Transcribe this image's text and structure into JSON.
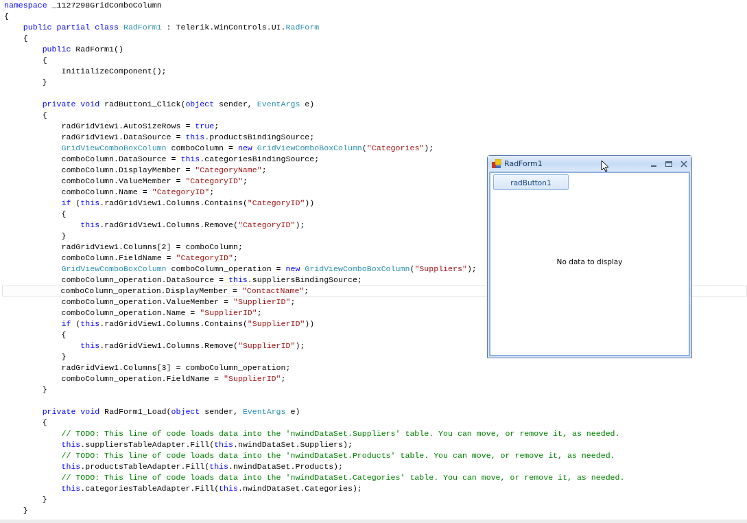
{
  "editor": {
    "lines": [
      {
        "current": false,
        "tokens": [
          {
            "kind": "kw",
            "text": "namespace"
          },
          {
            "kind": "plain",
            "text": " _1127298GridComboColumn"
          }
        ]
      },
      {
        "current": false,
        "tokens": [
          {
            "kind": "plain",
            "text": "{"
          }
        ]
      },
      {
        "current": false,
        "tokens": [
          {
            "kind": "kw",
            "text": "    public partial class "
          },
          {
            "kind": "type",
            "text": "RadForm1"
          },
          {
            "kind": "plain",
            "text": " : Telerik.WinControls.UI."
          },
          {
            "kind": "type",
            "text": "RadForm"
          }
        ]
      },
      {
        "current": false,
        "tokens": [
          {
            "kind": "plain",
            "text": "    {"
          }
        ]
      },
      {
        "current": false,
        "tokens": [
          {
            "kind": "kw",
            "text": "        public"
          },
          {
            "kind": "plain",
            "text": " RadForm1()"
          }
        ]
      },
      {
        "current": false,
        "tokens": [
          {
            "kind": "plain",
            "text": "        {"
          }
        ]
      },
      {
        "current": false,
        "tokens": [
          {
            "kind": "plain",
            "text": "            InitializeComponent();"
          }
        ]
      },
      {
        "current": false,
        "tokens": [
          {
            "kind": "plain",
            "text": "        }"
          }
        ]
      },
      {
        "current": false
      },
      {
        "current": false,
        "tokens": [
          {
            "kind": "kw",
            "text": "        private void"
          },
          {
            "kind": "plain",
            "text": " radButton1_Click("
          },
          {
            "kind": "kw",
            "text": "object"
          },
          {
            "kind": "plain",
            "text": " sender, "
          },
          {
            "kind": "type",
            "text": "EventArgs"
          },
          {
            "kind": "plain",
            "text": " e)"
          }
        ]
      },
      {
        "current": false,
        "tokens": [
          {
            "kind": "plain",
            "text": "        {"
          }
        ]
      },
      {
        "current": false,
        "tokens": [
          {
            "kind": "plain",
            "text": "            radGridView1.AutoSizeRows = "
          },
          {
            "kind": "kw",
            "text": "true"
          },
          {
            "kind": "plain",
            "text": ";"
          }
        ]
      },
      {
        "current": false,
        "tokens": [
          {
            "kind": "plain",
            "text": "            radGridView1.DataSource = "
          },
          {
            "kind": "kw",
            "text": "this"
          },
          {
            "kind": "plain",
            "text": ".productsBindingSource;"
          }
        ]
      },
      {
        "current": false,
        "tokens": [
          {
            "kind": "type",
            "text": "            GridViewComboBoxColumn"
          },
          {
            "kind": "plain",
            "text": " comboColumn = "
          },
          {
            "kind": "kw",
            "text": "new"
          },
          {
            "kind": "type",
            "text": " GridViewComboBoxColumn"
          },
          {
            "kind": "plain",
            "text": "("
          },
          {
            "kind": "str",
            "text": "\"Categories\""
          },
          {
            "kind": "plain",
            "text": ");"
          }
        ]
      },
      {
        "current": false,
        "tokens": [
          {
            "kind": "plain",
            "text": "            comboColumn.DataSource = "
          },
          {
            "kind": "kw",
            "text": "this"
          },
          {
            "kind": "plain",
            "text": ".categoriesBindingSource;"
          }
        ]
      },
      {
        "current": false,
        "tokens": [
          {
            "kind": "plain",
            "text": "            comboColumn.DisplayMember = "
          },
          {
            "kind": "str",
            "text": "\"CategoryName\""
          },
          {
            "kind": "plain",
            "text": ";"
          }
        ]
      },
      {
        "current": false,
        "tokens": [
          {
            "kind": "plain",
            "text": "            comboColumn.ValueMember = "
          },
          {
            "kind": "str",
            "text": "\"CategoryID\""
          },
          {
            "kind": "plain",
            "text": ";"
          }
        ]
      },
      {
        "current": false,
        "tokens": [
          {
            "kind": "plain",
            "text": "            comboColumn.Name = "
          },
          {
            "kind": "str",
            "text": "\"CategoryID\""
          },
          {
            "kind": "plain",
            "text": ";"
          }
        ]
      },
      {
        "current": false,
        "tokens": [
          {
            "kind": "kw",
            "text": "            if"
          },
          {
            "kind": "plain",
            "text": " ("
          },
          {
            "kind": "kw",
            "text": "this"
          },
          {
            "kind": "plain",
            "text": ".radGridView1.Columns.Contains("
          },
          {
            "kind": "str",
            "text": "\"CategoryID\""
          },
          {
            "kind": "plain",
            "text": "))"
          }
        ]
      },
      {
        "current": false,
        "tokens": [
          {
            "kind": "plain",
            "text": "            {"
          }
        ]
      },
      {
        "current": false,
        "tokens": [
          {
            "kind": "kw",
            "text": "                this"
          },
          {
            "kind": "plain",
            "text": ".radGridView1.Columns.Remove("
          },
          {
            "kind": "str",
            "text": "\"CategoryID\""
          },
          {
            "kind": "plain",
            "text": ");"
          }
        ]
      },
      {
        "current": false,
        "tokens": [
          {
            "kind": "plain",
            "text": "            }"
          }
        ]
      },
      {
        "current": false,
        "tokens": [
          {
            "kind": "plain",
            "text": "            radGridView1.Columns[2] = comboColumn;"
          }
        ]
      },
      {
        "current": false,
        "tokens": [
          {
            "kind": "plain",
            "text": "            comboColumn.FieldName = "
          },
          {
            "kind": "str",
            "text": "\"CategoryID\""
          },
          {
            "kind": "plain",
            "text": ";"
          }
        ]
      },
      {
        "current": false,
        "tokens": [
          {
            "kind": "type",
            "text": "            GridViewComboBoxColumn"
          },
          {
            "kind": "plain",
            "text": " comboColumn_operation = "
          },
          {
            "kind": "kw",
            "text": "new"
          },
          {
            "kind": "type",
            "text": " GridViewComboBoxColumn"
          },
          {
            "kind": "plain",
            "text": "("
          },
          {
            "kind": "str",
            "text": "\"Suppliers\""
          },
          {
            "kind": "plain",
            "text": ");"
          }
        ]
      },
      {
        "current": false,
        "tokens": [
          {
            "kind": "plain",
            "text": "            comboColumn_operation.DataSource = "
          },
          {
            "kind": "kw",
            "text": "this"
          },
          {
            "kind": "plain",
            "text": ".suppliersBindingSource;"
          }
        ]
      },
      {
        "current": true,
        "tokens": [
          {
            "kind": "plain",
            "text": "            comboColumn_operation.DisplayMember = "
          },
          {
            "kind": "str",
            "text": "\"ContactName\""
          },
          {
            "kind": "plain",
            "text": ";"
          }
        ]
      },
      {
        "current": false,
        "tokens": [
          {
            "kind": "plain",
            "text": "            comboColumn_operation.ValueMember = "
          },
          {
            "kind": "str",
            "text": "\"SupplierID\""
          },
          {
            "kind": "plain",
            "text": ";"
          }
        ]
      },
      {
        "current": false,
        "tokens": [
          {
            "kind": "plain",
            "text": "            comboColumn_operation.Name = "
          },
          {
            "kind": "str",
            "text": "\"SupplierID\""
          },
          {
            "kind": "plain",
            "text": ";"
          }
        ]
      },
      {
        "current": false,
        "tokens": [
          {
            "kind": "kw",
            "text": "            if"
          },
          {
            "kind": "plain",
            "text": " ("
          },
          {
            "kind": "kw",
            "text": "this"
          },
          {
            "kind": "plain",
            "text": ".radGridView1.Columns.Contains("
          },
          {
            "kind": "str",
            "text": "\"SupplierID\""
          },
          {
            "kind": "plain",
            "text": "))"
          }
        ]
      },
      {
        "current": false,
        "tokens": [
          {
            "kind": "plain",
            "text": "            {"
          }
        ]
      },
      {
        "current": false,
        "tokens": [
          {
            "kind": "kw",
            "text": "                this"
          },
          {
            "kind": "plain",
            "text": ".radGridView1.Columns.Remove("
          },
          {
            "kind": "str",
            "text": "\"SupplierID\""
          },
          {
            "kind": "plain",
            "text": ");"
          }
        ]
      },
      {
        "current": false,
        "tokens": [
          {
            "kind": "plain",
            "text": "            }"
          }
        ]
      },
      {
        "current": false,
        "tokens": [
          {
            "kind": "plain",
            "text": "            radGridView1.Columns[3] = comboColumn_operation;"
          }
        ]
      },
      {
        "current": false,
        "tokens": [
          {
            "kind": "plain",
            "text": "            comboColumn_operation.FieldName = "
          },
          {
            "kind": "str",
            "text": "\"SupplierID\""
          },
          {
            "kind": "plain",
            "text": ";"
          }
        ]
      },
      {
        "current": false,
        "tokens": [
          {
            "kind": "plain",
            "text": "        }"
          }
        ]
      },
      {
        "current": false
      },
      {
        "current": false,
        "tokens": [
          {
            "kind": "kw",
            "text": "        private void"
          },
          {
            "kind": "plain",
            "text": " RadForm1_Load("
          },
          {
            "kind": "kw",
            "text": "object"
          },
          {
            "kind": "plain",
            "text": " sender, "
          },
          {
            "kind": "type",
            "text": "EventArgs"
          },
          {
            "kind": "plain",
            "text": " e)"
          }
        ]
      },
      {
        "current": false,
        "tokens": [
          {
            "kind": "plain",
            "text": "        {"
          }
        ]
      },
      {
        "current": false,
        "tokens": [
          {
            "kind": "comment",
            "text": "            // TODO: This line of code loads data into the 'nwindDataSet.Suppliers' table. You can move, or remove it, as needed."
          }
        ]
      },
      {
        "current": false,
        "tokens": [
          {
            "kind": "kw",
            "text": "            this"
          },
          {
            "kind": "plain",
            "text": ".suppliersTableAdapter.Fill("
          },
          {
            "kind": "kw",
            "text": "this"
          },
          {
            "kind": "plain",
            "text": ".nwindDataSet.Suppliers);"
          }
        ]
      },
      {
        "current": false,
        "tokens": [
          {
            "kind": "comment",
            "text": "            // TODO: This line of code loads data into the 'nwindDataSet.Products' table. You can move, or remove it, as needed."
          }
        ]
      },
      {
        "current": false,
        "tokens": [
          {
            "kind": "kw",
            "text": "            this"
          },
          {
            "kind": "plain",
            "text": ".productsTableAdapter.Fill("
          },
          {
            "kind": "kw",
            "text": "this"
          },
          {
            "kind": "plain",
            "text": ".nwindDataSet.Products);"
          }
        ]
      },
      {
        "current": false,
        "tokens": [
          {
            "kind": "comment",
            "text": "            // TODO: This line of code loads data into the 'nwindDataSet.Categories' table. You can move, or remove it, as needed."
          }
        ]
      },
      {
        "current": false,
        "tokens": [
          {
            "kind": "kw",
            "text": "            this"
          },
          {
            "kind": "plain",
            "text": ".categoriesTableAdapter.Fill("
          },
          {
            "kind": "kw",
            "text": "this"
          },
          {
            "kind": "plain",
            "text": ".nwindDataSet.Categories);"
          }
        ]
      },
      {
        "current": false,
        "tokens": [
          {
            "kind": "plain",
            "text": "        }"
          }
        ]
      },
      {
        "current": false,
        "tokens": [
          {
            "kind": "plain",
            "text": "    }"
          }
        ]
      }
    ]
  },
  "form_window": {
    "title": "RadForm1",
    "button": "radButton1",
    "empty_message": "No data to display"
  }
}
